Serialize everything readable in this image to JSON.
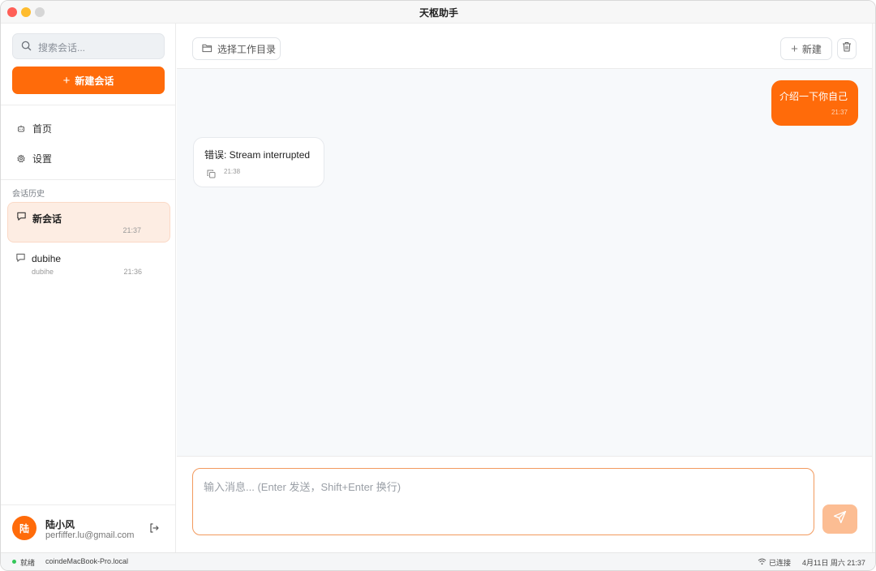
{
  "window": {
    "title": "天枢助手"
  },
  "sidebar": {
    "search_placeholder": "搜索会话...",
    "new_chat_label": "新建会话",
    "nav": [
      {
        "label": "首页",
        "icon": "bot-icon"
      },
      {
        "label": "设置",
        "icon": "gear-icon"
      }
    ],
    "history_label": "会话历史",
    "conversations": [
      {
        "title": "新会话",
        "subtitle": "",
        "time": "21:37",
        "active": true
      },
      {
        "title": "dubihe",
        "subtitle": "dubihe",
        "time": "21:36",
        "active": false
      }
    ],
    "user": {
      "avatar_text": "陆",
      "name": "陆小风",
      "email": "perfiffer.lu@gmail.com"
    }
  },
  "toolbar": {
    "select_dir_label": "选择工作目录",
    "new_label": "新建"
  },
  "messages": [
    {
      "role": "user",
      "text": "介绍一下你自己",
      "time": "21:37"
    },
    {
      "role": "assistant",
      "text": "错误: Stream interrupted",
      "time": "21:38"
    }
  ],
  "composer": {
    "placeholder": "输入消息... (Enter 发送，Shift+Enter 换行)"
  },
  "statusbar": {
    "status": "就绪",
    "host": "coindeMacBook-Pro.local",
    "connection": "已连接",
    "datetime": "4月11日 周六 21:37"
  },
  "colors": {
    "accent": "#ff6b0a",
    "accent_light": "#fcbd93",
    "active_conv_bg": "#fdede3",
    "status_ok": "#34c759"
  }
}
